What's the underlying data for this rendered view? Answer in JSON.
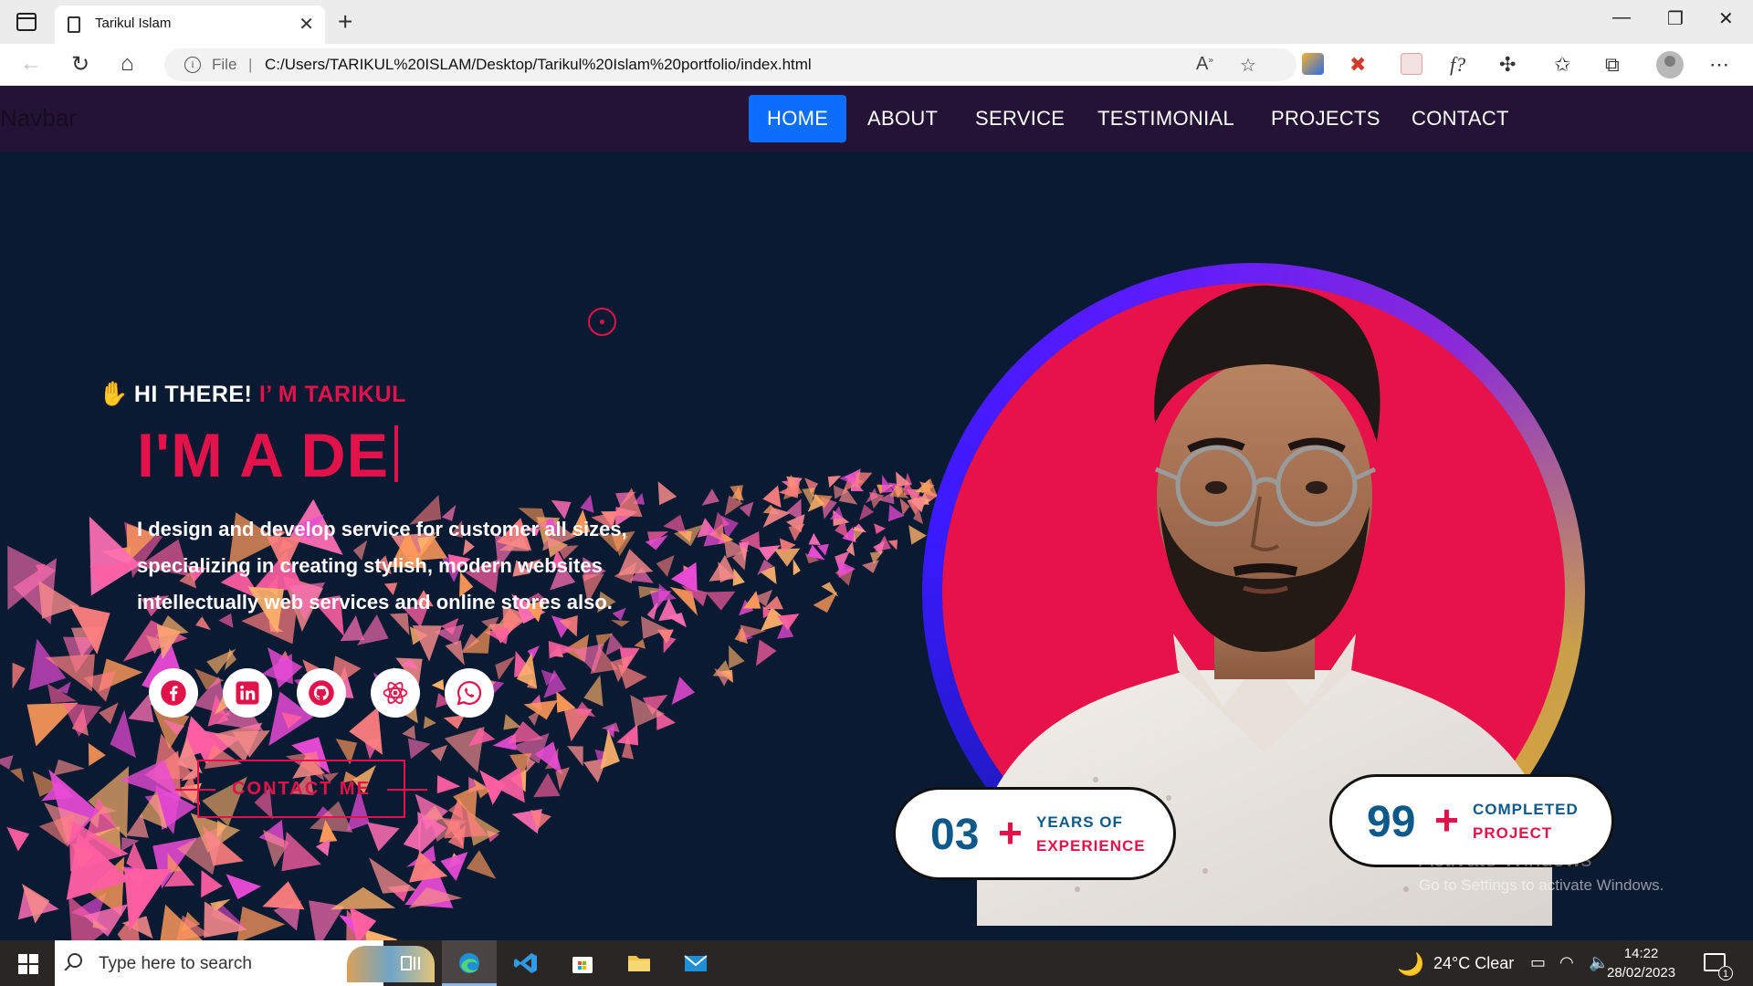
{
  "browser": {
    "tab_title": "Tarikul Islam",
    "file_label": "File",
    "separator": "|",
    "url": "C:/Users/TARIKUL%20ISLAM/Desktop/Tarikul%20Islam%20portfolio/index.html"
  },
  "site": {
    "brand": "Navbar",
    "nav": [
      {
        "label": "HOME",
        "active": true
      },
      {
        "label": "ABOUT"
      },
      {
        "label": "SERVICE"
      },
      {
        "label": "TESTIMONIAL"
      },
      {
        "label": "PROJECTS"
      },
      {
        "label": "CONTACT"
      }
    ],
    "hero": {
      "hand": "✋",
      "greeting": "HI THERE! ",
      "name": "I’ M TARIKUL",
      "title": "I'M A DE",
      "intro": "I design and develop service for customer all sizes, specializing in creating stylish, modern websites intellectually web services and online stores also.",
      "cta": "CONTACT ME"
    },
    "social": [
      {
        "icon": "facebook-icon"
      },
      {
        "icon": "linkedin-icon"
      },
      {
        "icon": "github-icon"
      },
      {
        "icon": "react-icon"
      },
      {
        "icon": "whatsapp-icon"
      }
    ],
    "stats": [
      {
        "number": "03",
        "plus": "+",
        "line1": "YEARS OF",
        "line2": "EXPERIENCE"
      },
      {
        "number": "99",
        "plus": "+",
        "line1": "COMPLETED",
        "line2": "PROJECT"
      }
    ],
    "colors": {
      "accent": "#e2124a",
      "nav_bg": "#241336",
      "page_bg": "#0b1a33",
      "active_nav": "#0d6efd",
      "stat_number": "#0d5a8a"
    }
  },
  "watermark": {
    "line1": "Activate Windows",
    "line2": "Go to Settings to activate Windows."
  },
  "taskbar": {
    "search_placeholder": "Type here to search",
    "weather": "24°C  Clear",
    "time": "14:22",
    "date": "28/02/2023",
    "notifications": "1"
  }
}
